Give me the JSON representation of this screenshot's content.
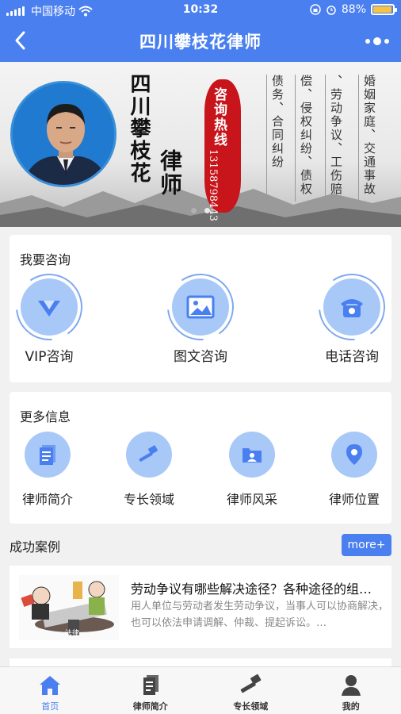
{
  "status_bar": {
    "carrier": "中国移动",
    "time": "10:32",
    "battery": "88%",
    "battery_level": 0.88
  },
  "nav": {
    "title": "四川攀枝花律师"
  },
  "banner": {
    "title_calligraphy": "四川攀枝花",
    "lawyer_calligraphy": "律师",
    "hotline_label": "咨询热线",
    "hotline_number": "13158798443",
    "services": [
      "婚姻家庭、交通事故",
      "、劳动争议、工伤赔",
      "偿、侵权纠纷、债权",
      "债务、合同纠纷"
    ]
  },
  "consult": {
    "title": "我要咨询",
    "items": [
      {
        "label": "VIP咨询",
        "icon": "vip-icon"
      },
      {
        "label": "图文咨询",
        "icon": "image-icon"
      },
      {
        "label": "电话咨询",
        "icon": "phone-icon"
      }
    ]
  },
  "more_info": {
    "title": "更多信息",
    "items": [
      {
        "label": "律师简介",
        "icon": "document-icon"
      },
      {
        "label": "专长领域",
        "icon": "gavel-icon"
      },
      {
        "label": "律师风采",
        "icon": "folder-icon"
      },
      {
        "label": "律师位置",
        "icon": "location-icon"
      }
    ]
  },
  "cases": {
    "title": "成功案例",
    "more_label": "more+",
    "items": [
      {
        "title": "劳动争议有哪些解决途径？各种途径的组…",
        "description": "用人单位与劳动者发生劳动争议，当事人可以协商解决，也可以依法申请调解、仲裁、提起诉讼。…",
        "image_text": "法律"
      }
    ]
  },
  "tabs": [
    {
      "label": "首页",
      "icon": "home-icon"
    },
    {
      "label": "律师简介",
      "icon": "document-icon"
    },
    {
      "label": "专长领域",
      "icon": "gavel-icon"
    },
    {
      "label": "我的",
      "icon": "user-icon"
    }
  ],
  "colors": {
    "brand": "#4a7ff0",
    "icon_bg": "#a8c8f8",
    "seal": "#c8141b"
  }
}
